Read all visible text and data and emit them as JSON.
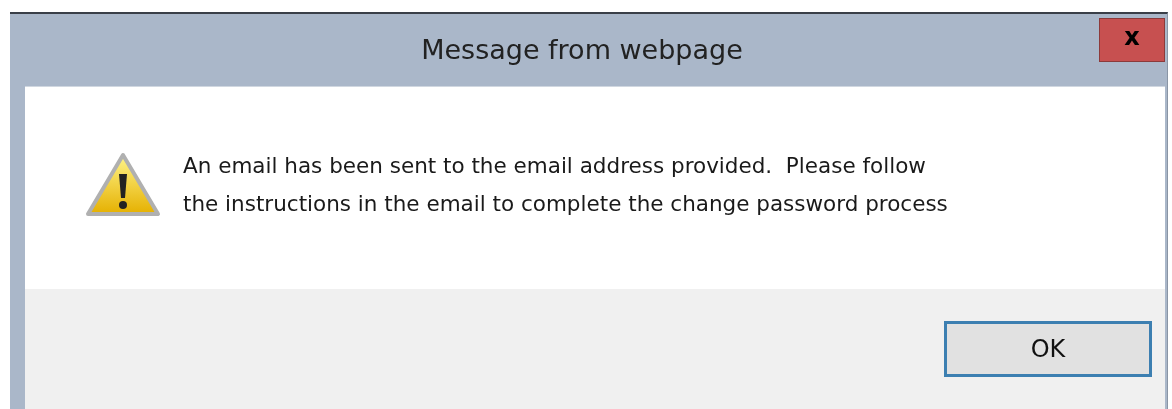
{
  "window": {
    "title": "Message from webpage",
    "close_button": {
      "label": "x"
    }
  },
  "message": {
    "kind": "warning",
    "text": "An email has been sent to the email address provided.  Please follow\nthe instructions in the email to complete the change password process"
  },
  "buttons": [
    {
      "label": "OK",
      "selected": true
    }
  ]
}
